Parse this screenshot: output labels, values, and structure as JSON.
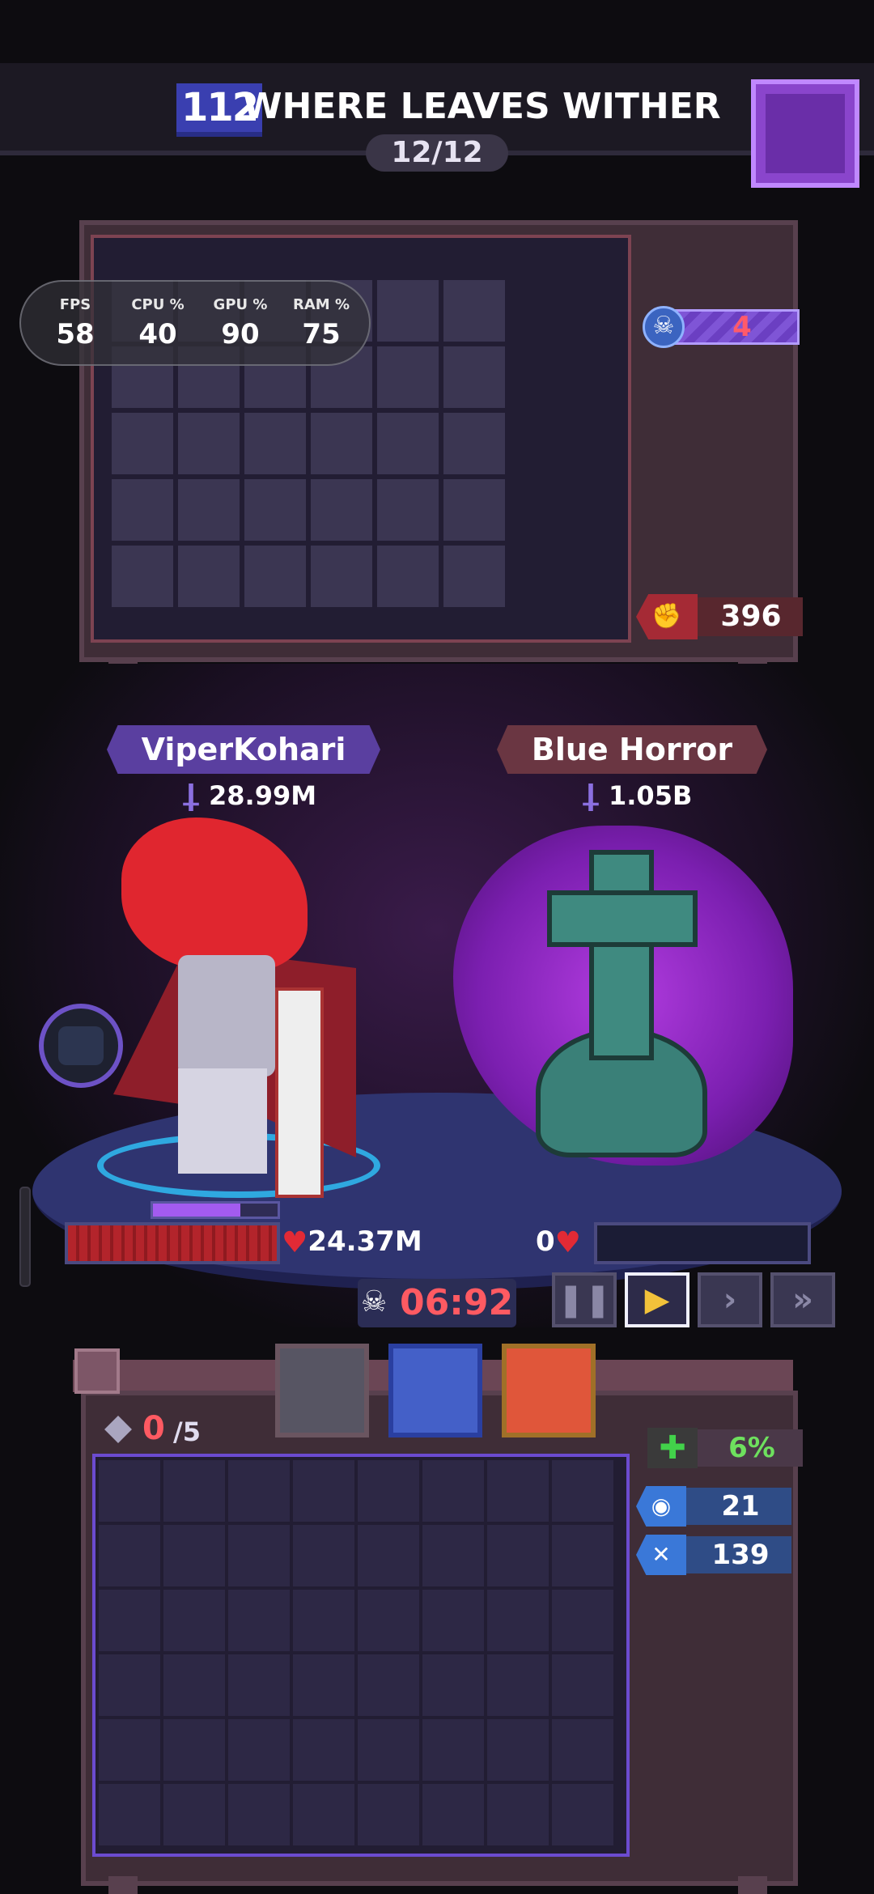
{
  "header": {
    "stage_number": "112",
    "stage_title": "WHERE LEAVES WITHER",
    "progress": "12/12"
  },
  "perf": {
    "fps_label": "FPS",
    "fps": "58",
    "cpu_label": "CPU %",
    "cpu": "40",
    "gpu_label": "GPU %",
    "gpu": "90",
    "ram_label": "RAM %",
    "ram": "75"
  },
  "equipment": {
    "skull_count": "4",
    "power_value": "396"
  },
  "battle": {
    "player_name": "ViperKohari",
    "player_power": "28.99M",
    "enemy_name": "Blue Horror",
    "enemy_power": "1.05B",
    "player_hp": "24.37M",
    "player_hp_fraction": 1.0,
    "player_xp_fraction": 0.7,
    "enemy_hp": "0",
    "enemy_hp_fraction": 0.0,
    "timer": "06:92",
    "speed_buttons": [
      "❚❚",
      "▶",
      "›",
      "»"
    ]
  },
  "inventory": {
    "slots_used": "0",
    "slots_max": "/5",
    "heal_percent": "6%",
    "stat_a": "21",
    "stat_b": "139"
  },
  "colors": {
    "accent_purple": "#8a45cc",
    "hp_red": "#b3242b",
    "timer_red": "#ff5a62",
    "heal_green": "#6ee05e",
    "stat_blue": "#2f4c86"
  }
}
